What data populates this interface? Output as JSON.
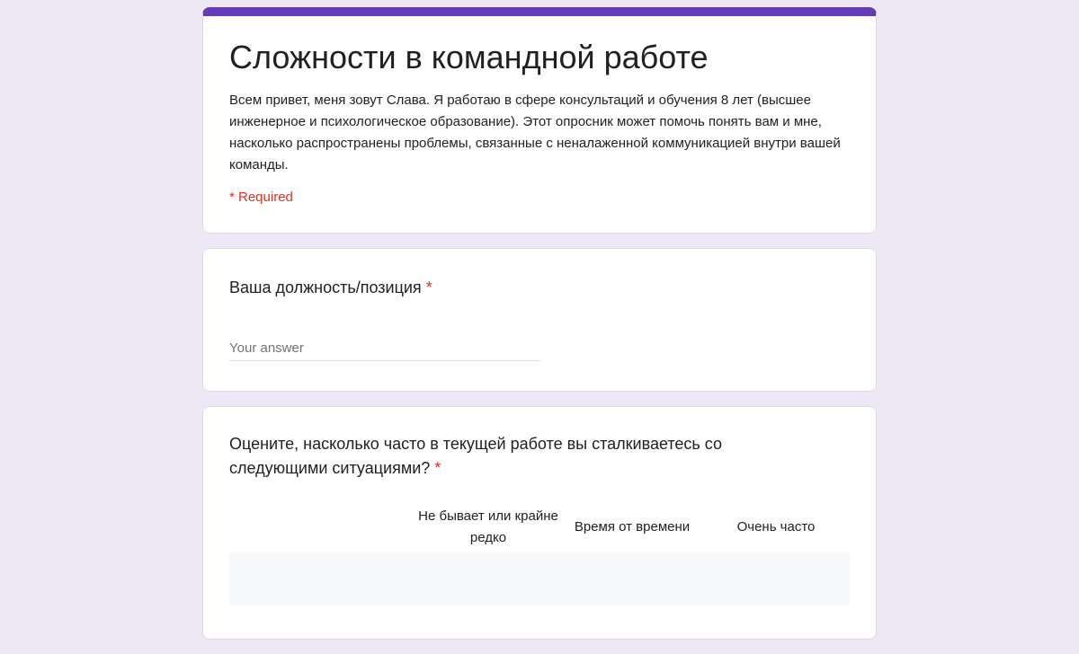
{
  "form": {
    "title": "Сложности в командной работе",
    "description": "Всем привет, меня зовут Слава. Я работаю в сфере консультаций и обучения 8 лет (высшее инженерное и психологическое образование). Этот опросник может помочь понять вам и мне, насколько распространены проблемы, связанные с неналаженной коммуникацией внутри вашей команды.",
    "required_note": "* Required",
    "accent_color": "#673ab7",
    "background_color": "#ede7f6"
  },
  "questions": [
    {
      "title": "Ваша должность/позиция",
      "required_mark": "*",
      "placeholder": "Your answer"
    },
    {
      "title": "Оцените, насколько часто в текущей работе вы сталкиваетесь со следующими ситуациями?",
      "required_mark": "*",
      "columns": [
        "Не бывает или крайне редко",
        "Время от времени",
        "Очень часто"
      ]
    }
  ]
}
